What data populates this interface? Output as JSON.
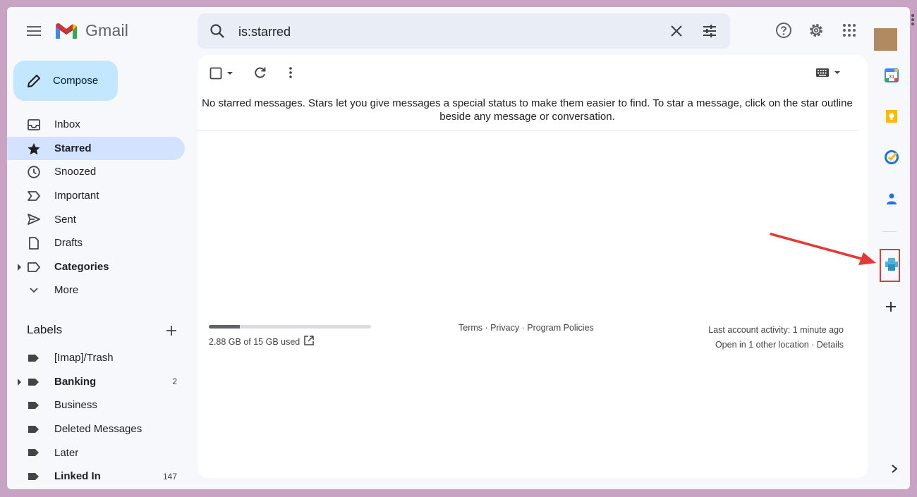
{
  "app": {
    "name": "Gmail"
  },
  "search": {
    "query": "is:starred"
  },
  "compose": {
    "label": "Compose"
  },
  "nav": [
    {
      "label": "Inbox",
      "icon": "inbox-icon",
      "active": false,
      "bold": false,
      "count": ""
    },
    {
      "label": "Starred",
      "icon": "star-icon",
      "active": true,
      "bold": true,
      "count": ""
    },
    {
      "label": "Snoozed",
      "icon": "clock-icon",
      "active": false,
      "bold": false,
      "count": ""
    },
    {
      "label": "Important",
      "icon": "important-icon",
      "active": false,
      "bold": false,
      "count": ""
    },
    {
      "label": "Sent",
      "icon": "send-icon",
      "active": false,
      "bold": false,
      "count": ""
    },
    {
      "label": "Drafts",
      "icon": "draft-icon",
      "active": false,
      "bold": false,
      "count": ""
    },
    {
      "label": "Categories",
      "icon": "label-outline-icon",
      "active": false,
      "bold": true,
      "count": "",
      "expandable": true
    },
    {
      "label": "More",
      "icon": "chevron-down-icon",
      "active": false,
      "bold": false,
      "count": ""
    }
  ],
  "labels": {
    "title": "Labels",
    "items": [
      {
        "label": "[Imap]/Trash",
        "bold": false,
        "count": "",
        "expandable": false
      },
      {
        "label": "Banking",
        "bold": true,
        "count": "2",
        "expandable": true
      },
      {
        "label": "Business",
        "bold": false,
        "count": "",
        "expandable": false
      },
      {
        "label": "Deleted Messages",
        "bold": false,
        "count": "",
        "expandable": false
      },
      {
        "label": "Later",
        "bold": false,
        "count": "",
        "expandable": false
      },
      {
        "label": "Linked In",
        "bold": true,
        "count": "147",
        "expandable": false
      }
    ]
  },
  "main": {
    "empty_message_line1": "No starred messages. Stars let you give messages a special status to make them easier to find. To star a message, click on the star outline",
    "empty_message_line2": "beside any message or conversation."
  },
  "footer": {
    "storage_text": "2.88 GB of 15 GB used",
    "storage_used_fraction": 0.192,
    "terms": "Terms",
    "privacy": "Privacy",
    "policies": "Program Policies",
    "sep": " · ",
    "activity_line1": "Last account activity: 1 minute ago",
    "activity_line2": "Open in 1 other location",
    "details": "Details"
  },
  "side_apps": [
    {
      "name": "calendar-icon",
      "label": "31"
    },
    {
      "name": "keep-icon"
    },
    {
      "name": "tasks-icon"
    },
    {
      "name": "contacts-icon"
    },
    {
      "name": "addon-icon"
    }
  ],
  "colors": {
    "compose_bg": "#c2e7ff",
    "active_nav_bg": "#d3e3fd",
    "highlight": "#e53935",
    "page_bg": "#f6f8fc"
  }
}
